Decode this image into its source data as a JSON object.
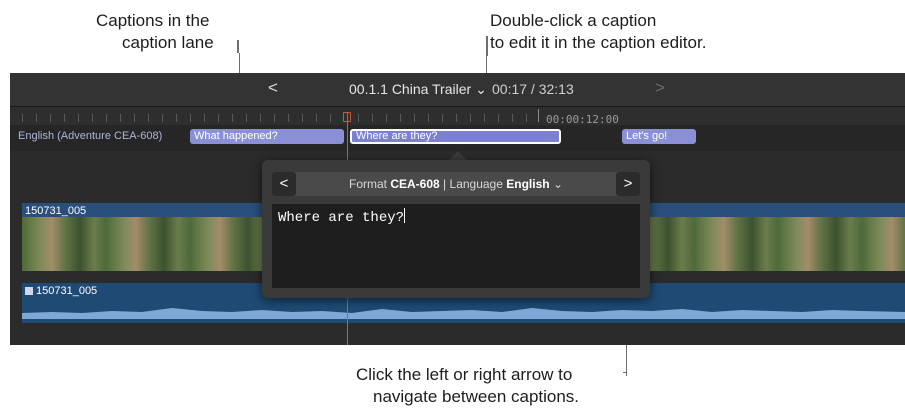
{
  "callouts": {
    "lane_line1": "Captions in the",
    "lane_line2": "caption lane",
    "edit_line1": "Double-click a caption",
    "edit_line2": "to edit it in the caption editor.",
    "nav_line1": "Click the left or right arrow to",
    "nav_line2": "navigate between captions."
  },
  "toolbar": {
    "prev_arrow": "<",
    "next_arrow": ">",
    "project_title": "00.1.1 China Trailer",
    "title_chevron": "⌄",
    "timecode": "00:17 / 32:13"
  },
  "ruler": {
    "timecode": "00:00:12:00"
  },
  "caption_lane": {
    "name": "English (Adventure CEA-608)",
    "captions": [
      "What happened?",
      "Where are they?",
      "Let's go!"
    ]
  },
  "video_clip": {
    "name": "150731_005"
  },
  "audio_clip": {
    "name": "150731_005"
  },
  "editor": {
    "prev_button": "<",
    "next_button": ">",
    "format_label": "Format",
    "format_value": "CEA-608",
    "separator": "|",
    "language_label": "Language",
    "language_value": "English",
    "chevron": "⌄",
    "caption_text": "Where are they?"
  },
  "colors": {
    "caption": "#8b90d6",
    "playhead": "#d4553a",
    "video_clip": "#2a4f7a",
    "audio_clip": "#1f4a73"
  }
}
